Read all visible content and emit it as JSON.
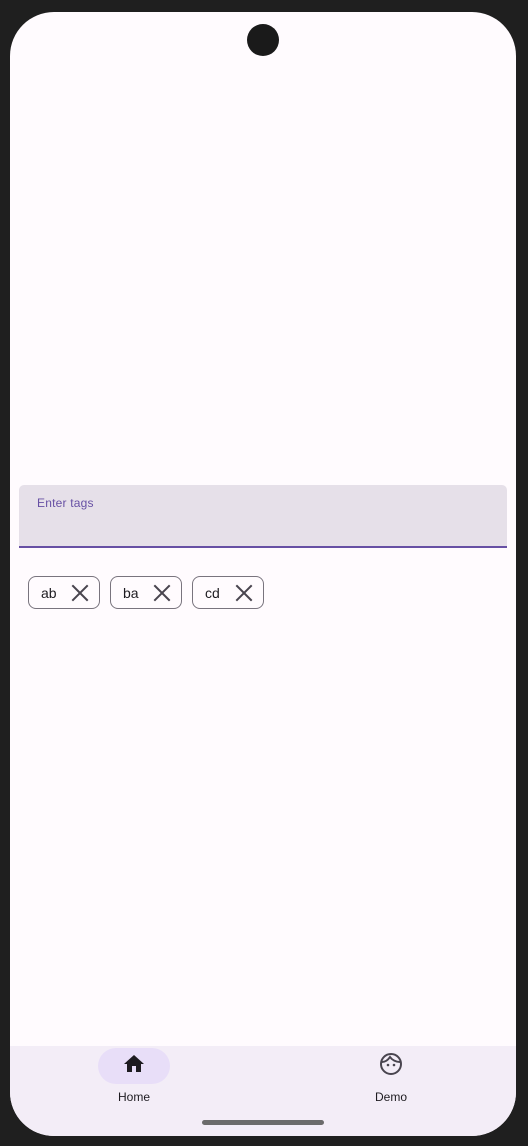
{
  "text_field": {
    "label": "Enter tags",
    "value": ""
  },
  "chips": [
    {
      "label": "ab",
      "icon": "close-icon"
    },
    {
      "label": "ba",
      "icon": "close-icon"
    },
    {
      "label": "cd",
      "icon": "close-icon"
    }
  ],
  "bottom_nav": {
    "items": [
      {
        "label": "Home",
        "icon": "home-icon",
        "selected": true
      },
      {
        "label": "Demo",
        "icon": "face-icon",
        "selected": false
      }
    ]
  },
  "colors": {
    "accent": "#6750a4",
    "field_background": "#e6e0e9",
    "nav_background": "#f3edf7",
    "nav_indicator": "#e8def8",
    "chip_border": "#79747e"
  }
}
